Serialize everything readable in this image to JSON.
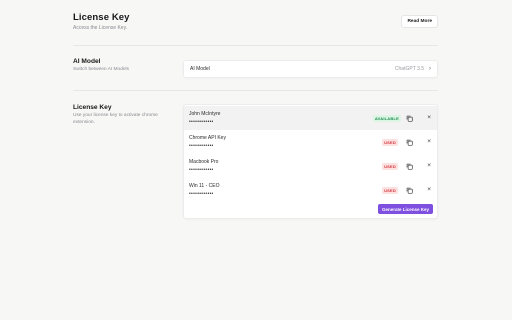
{
  "header": {
    "title": "License Key",
    "subtitle": "Access the License Key.",
    "read_more_label": "Read More"
  },
  "ai_model_section": {
    "title": "AI Model",
    "description": "Switch between AI Models",
    "row_label": "AI Model",
    "row_value": "ChatGPT 3.5",
    "chevron_icon": "chevron-right-icon"
  },
  "license_section": {
    "title": "License Key",
    "description": "Use your license key to activate chrome extension.",
    "generate_label": "Generate License Key",
    "keys": [
      {
        "name": "John McIntyre",
        "masked": "••••••••••••",
        "status": "AVAILABLE",
        "active": true
      },
      {
        "name": "Chrome API Key",
        "masked": "••••••••••••",
        "status": "USED",
        "active": false
      },
      {
        "name": "Macbook Pro",
        "masked": "••••••••••••",
        "status": "USED",
        "active": false
      },
      {
        "name": "Win 11 - CEO",
        "masked": "••••••••••••",
        "status": "USED",
        "active": false
      }
    ]
  },
  "colors": {
    "accent": "#7f4fe0",
    "available_bg": "#dcf5e5",
    "available_fg": "#1b8c4a",
    "used_bg": "#fde1e1",
    "used_fg": "#d2333b"
  },
  "icons": {
    "copy": "copy-icon",
    "close": "close-icon",
    "chevron": "chevron-right-icon"
  }
}
